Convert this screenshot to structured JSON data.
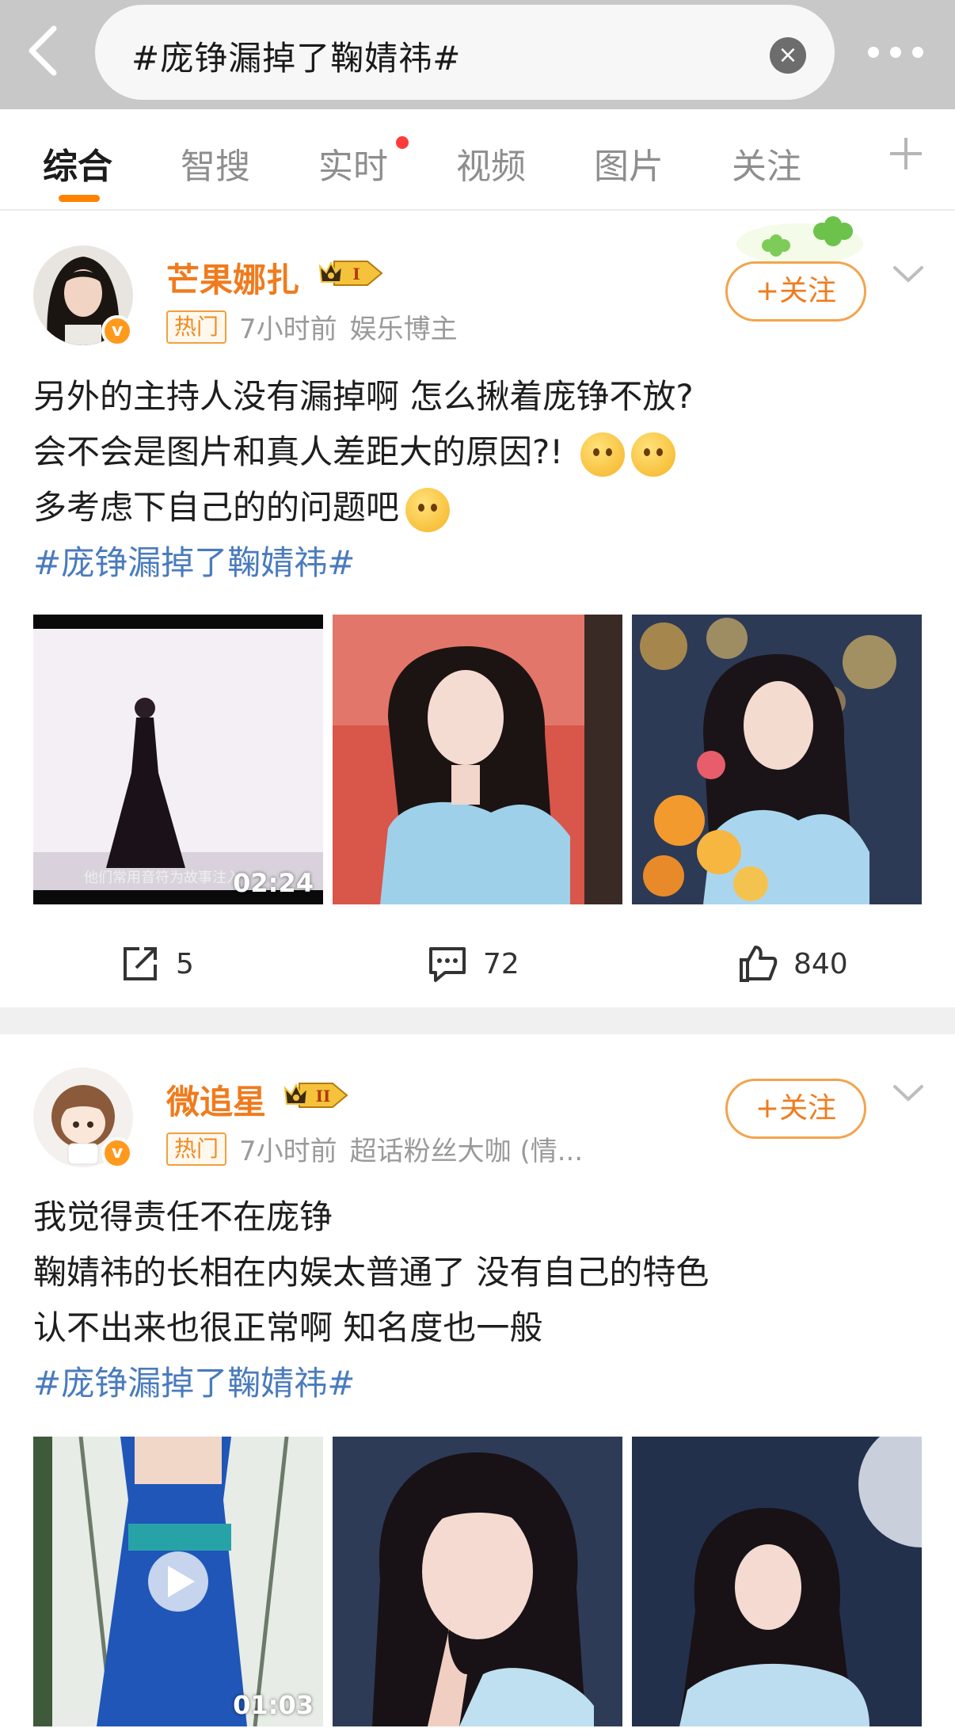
{
  "header": {
    "search_query": "#庞铮漏掉了鞠婧祎#",
    "back_icon": "chevron-left-icon",
    "clear_icon": "clear-icon",
    "more_icon": "more-dots-icon"
  },
  "tabs": [
    {
      "label": "综合",
      "active": true
    },
    {
      "label": "智搜"
    },
    {
      "label": "实时",
      "has_dot": true
    },
    {
      "label": "视频"
    },
    {
      "label": "图片"
    },
    {
      "label": "关注"
    }
  ],
  "colors": {
    "accent": "#ff8200",
    "username": "#f07b1d",
    "hashtag": "#4a7bbd",
    "header_bg": "#c8c8c8"
  },
  "posts": [
    {
      "username": "芒果娜扎",
      "rank": "I",
      "hot_tag": "热门",
      "time": "7小时前",
      "source": "娱乐博主",
      "follow_label": "+关注",
      "lines": [
        "另外的主持人没有漏掉啊 怎么揪着庞铮不放?",
        "会不会是图片和真人差距大的原因?!",
        "多考虑下自己的的问题吧"
      ],
      "hashtag": "#庞铮漏掉了鞠婧祎#",
      "video_duration": "02:24",
      "video_caption": "他们常用音符为故事注入",
      "repost_count": "5",
      "comment_count": "72",
      "like_count": "840"
    },
    {
      "username": "微追星",
      "rank": "II",
      "hot_tag": "热门",
      "time": "7小时前",
      "source": "超话粉丝大咖 (情...",
      "follow_label": "+关注",
      "lines": [
        "我觉得责任不在庞铮",
        "鞠婧祎的长相在内娱太普通了 没有自己的特色",
        "认不出来也很正常啊  知名度也一般"
      ],
      "hashtag": "#庞铮漏掉了鞠婧祎#",
      "video_duration": "01:03"
    }
  ]
}
